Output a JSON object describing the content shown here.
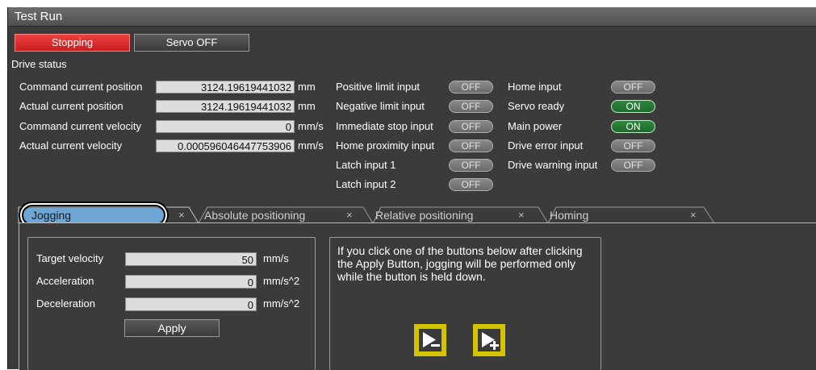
{
  "window": {
    "title": "Test Run"
  },
  "controls": {
    "stopping_label": "Stopping",
    "servo_off_label": "Servo OFF"
  },
  "drive_status": {
    "heading": "Drive status",
    "command_position": {
      "label": "Command current position",
      "value": "3124.19619441032",
      "unit": "mm"
    },
    "actual_position": {
      "label": "Actual current position",
      "value": "3124.19619441032",
      "unit": "mm"
    },
    "command_velocity": {
      "label": "Command current velocity",
      "value": "0",
      "unit": "mm/s"
    },
    "actual_velocity": {
      "label": "Actual current velocity",
      "value": "0.000596046447753906",
      "unit": "mm/s"
    }
  },
  "inputs": {
    "positive_limit": {
      "label": "Positive limit input",
      "state": "OFF"
    },
    "negative_limit": {
      "label": "Negative limit input",
      "state": "OFF"
    },
    "immediate_stop": {
      "label": "Immediate stop input",
      "state": "OFF"
    },
    "home_proximity": {
      "label": "Home proximity input",
      "state": "OFF"
    },
    "latch1": {
      "label": "Latch input 1",
      "state": "OFF"
    },
    "latch2": {
      "label": "Latch input 2",
      "state": "OFF"
    },
    "home_input": {
      "label": "Home input",
      "state": "OFF"
    },
    "servo_ready": {
      "label": "Servo ready",
      "state": "ON"
    },
    "main_power": {
      "label": "Main power",
      "state": "ON"
    },
    "drive_error": {
      "label": "Drive error input",
      "state": "OFF"
    },
    "drive_warning": {
      "label": "Drive warning input",
      "state": "OFF"
    }
  },
  "tabs": [
    {
      "label": "Jogging",
      "close": "×"
    },
    {
      "label": "Absolute positioning",
      "close": "×"
    },
    {
      "label": "Relative positioning",
      "close": "×"
    },
    {
      "label": "Homing",
      "close": "×"
    }
  ],
  "jogging": {
    "target_velocity": {
      "label": "Target velocity",
      "value": "50",
      "unit": "mm/s"
    },
    "acceleration": {
      "label": "Acceleration",
      "value": "0",
      "unit": "mm/s^2"
    },
    "deceleration": {
      "label": "Deceleration",
      "value": "0",
      "unit": "mm/s^2"
    },
    "apply_label": "Apply",
    "instructions": "If you click one of the buttons below after clicking the Apply Button, jogging will be performed only while the button is held down."
  },
  "colors": {
    "accent_red": "#dd2a2a",
    "on_green": "#2a7d36",
    "tab_highlight": "#6ea6d6",
    "jog_button_border": "#d4c400"
  },
  "icons": {
    "jog_reverse": "jog-reverse-icon",
    "jog_forward": "jog-forward-icon"
  }
}
